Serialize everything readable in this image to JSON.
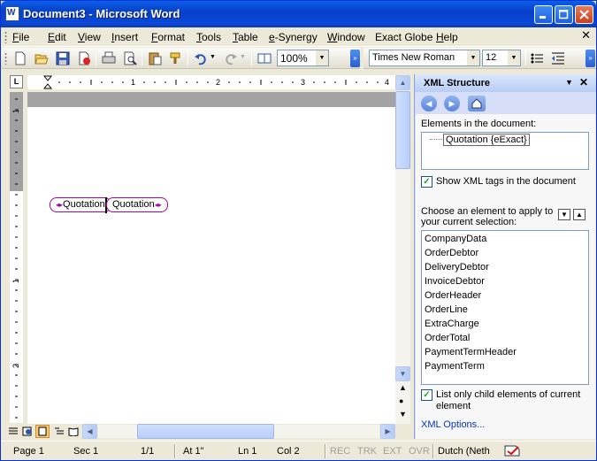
{
  "window": {
    "title": "Document3 - Microsoft Word"
  },
  "menubar": {
    "items": [
      {
        "label": "File",
        "u": "F",
        "rest": "ile"
      },
      {
        "label": "Edit",
        "u": "E",
        "rest": "dit"
      },
      {
        "label": "View",
        "u": "V",
        "rest": "iew"
      },
      {
        "label": "Insert",
        "u": "I",
        "rest": "nsert"
      },
      {
        "label": "Format",
        "u": "F",
        "rest": "ormat"
      },
      {
        "label": "Tools",
        "u": "T",
        "rest": "ools"
      },
      {
        "label": "Table",
        "u": "T",
        "rest": "able"
      },
      {
        "label": "e-Synergy",
        "u": "e",
        "rest": "-Synergy"
      },
      {
        "label": "Window",
        "u": "W",
        "rest": "indow"
      },
      {
        "label": "Exact Globe",
        "u": "",
        "rest": "Exact Globe"
      },
      {
        "label": "Help",
        "u": "H",
        "rest": "elp"
      }
    ]
  },
  "toolbar": {
    "zoom": "100%",
    "font": "Times New Roman",
    "size": "12"
  },
  "ruler": {
    "numbers": [
      "1",
      "2",
      "3",
      "4"
    ],
    "corner": "L"
  },
  "document": {
    "xml_open": "Quotation",
    "xml_close": "Quotation"
  },
  "status": {
    "page": "Page 1",
    "sec": "Sec 1",
    "pages": "1/1",
    "at": "At 1\"",
    "ln": "Ln 1",
    "col": "Col 2",
    "rec": "REC",
    "trk": "TRK",
    "ext": "EXT",
    "ovr": "OVR",
    "lang": "Dutch (Neth"
  },
  "pane": {
    "title": "XML Structure",
    "elements_label": "Elements in the document:",
    "tree_node": "Quotation {eExact}",
    "show_tags_label": "Show XML tags in the document",
    "choose_label_1": "Choose an element to apply to",
    "choose_label_2": "your current selection:",
    "elements": [
      "CompanyData",
      "OrderDebtor",
      "DeliveryDebtor",
      "InvoiceDebtor",
      "OrderHeader",
      "OrderLine",
      "ExtraCharge",
      "OrderTotal",
      "PaymentTermHeader",
      "PaymentTerm"
    ],
    "child_only_label_1": "List only child elements of current",
    "child_only_label_2": "element",
    "options_link": "XML Options..."
  }
}
